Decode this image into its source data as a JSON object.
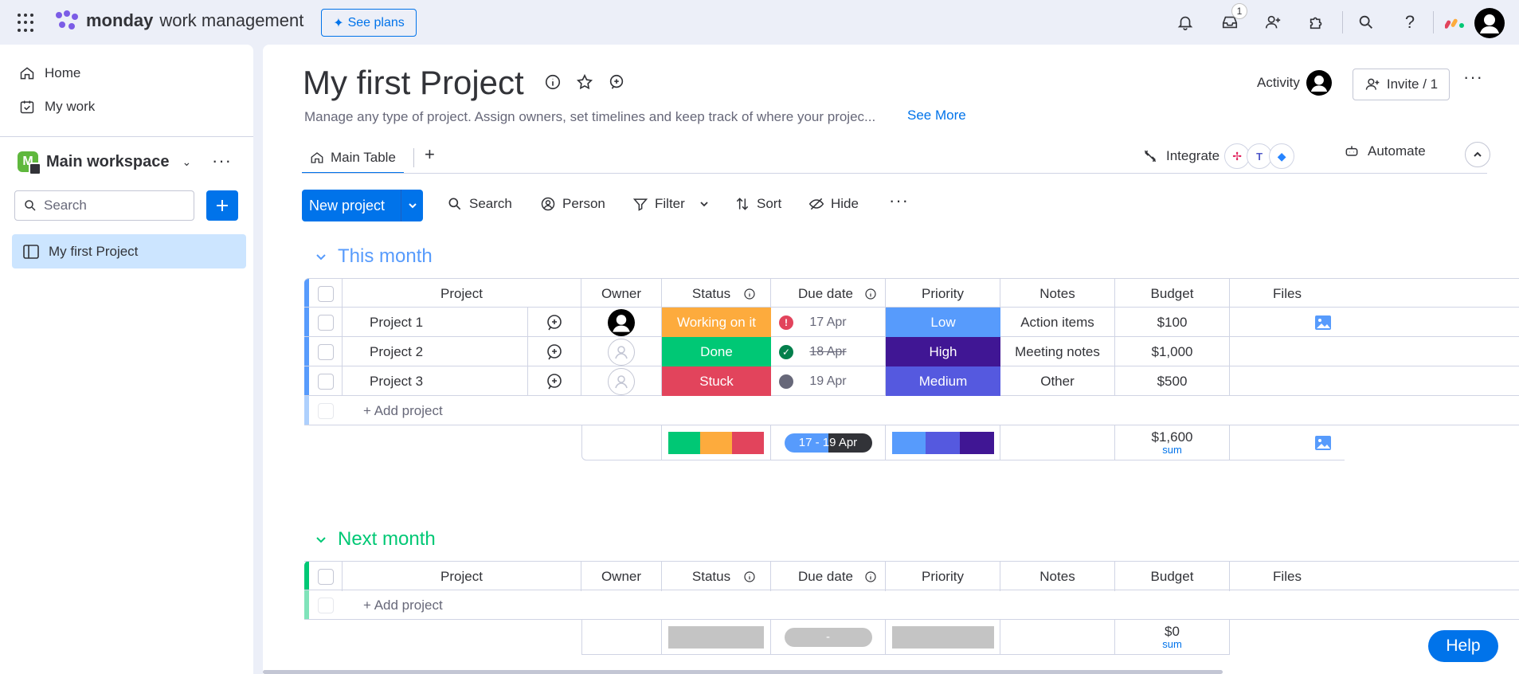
{
  "topbar": {
    "brand": "monday",
    "brand_sub": "work management",
    "see_plans": "See plans",
    "inbox_badge": "1"
  },
  "sidebar": {
    "home": "Home",
    "my_work": "My work",
    "workspace_initial": "M",
    "workspace_name": "Main workspace",
    "search_placeholder": "Search",
    "board": "My first Project"
  },
  "board": {
    "title": "My first Project",
    "description": "Manage any type of project. Assign owners, set timelines and keep track of where your projec...",
    "see_more": "See More",
    "activity": "Activity",
    "invite": "Invite / 1",
    "tab_main": "Main Table",
    "tab_add": "+",
    "integrate": "Integrate",
    "automate": "Automate"
  },
  "toolbar": {
    "new_project": "New project",
    "search": "Search",
    "person": "Person",
    "filter": "Filter",
    "sort": "Sort",
    "hide": "Hide"
  },
  "columns": {
    "project": "Project",
    "owner": "Owner",
    "status": "Status",
    "due_date": "Due date",
    "priority": "Priority",
    "notes": "Notes",
    "budget": "Budget",
    "files": "Files"
  },
  "colors": {
    "working": "#fdab3d",
    "done": "#00c875",
    "stuck": "#e2445c",
    "low": "#579bfc",
    "high": "#401694",
    "medium": "#5559df",
    "this_month": "#579bfc",
    "next_month": "#00c875"
  },
  "groups": [
    {
      "name": "This month",
      "add_label": "+ Add project",
      "rows": [
        {
          "project": "Project 1",
          "status": "Working on it",
          "due": "17 Apr",
          "priority": "Low",
          "notes": "Action items",
          "budget": "$100"
        },
        {
          "project": "Project 2",
          "status": "Done",
          "due": "18 Apr",
          "priority": "High",
          "notes": "Meeting notes",
          "budget": "$1,000"
        },
        {
          "project": "Project 3",
          "status": "Stuck",
          "due": "19 Apr",
          "priority": "Medium",
          "notes": "Other",
          "budget": "$500"
        }
      ],
      "summary": {
        "date_range": "17 - 19 Apr",
        "budget": "$1,600",
        "budget_label": "sum"
      }
    },
    {
      "name": "Next month",
      "add_label": "+ Add project",
      "rows": [],
      "summary": {
        "date_range": "-",
        "budget": "$0",
        "budget_label": "sum"
      }
    }
  ],
  "help": "Help"
}
